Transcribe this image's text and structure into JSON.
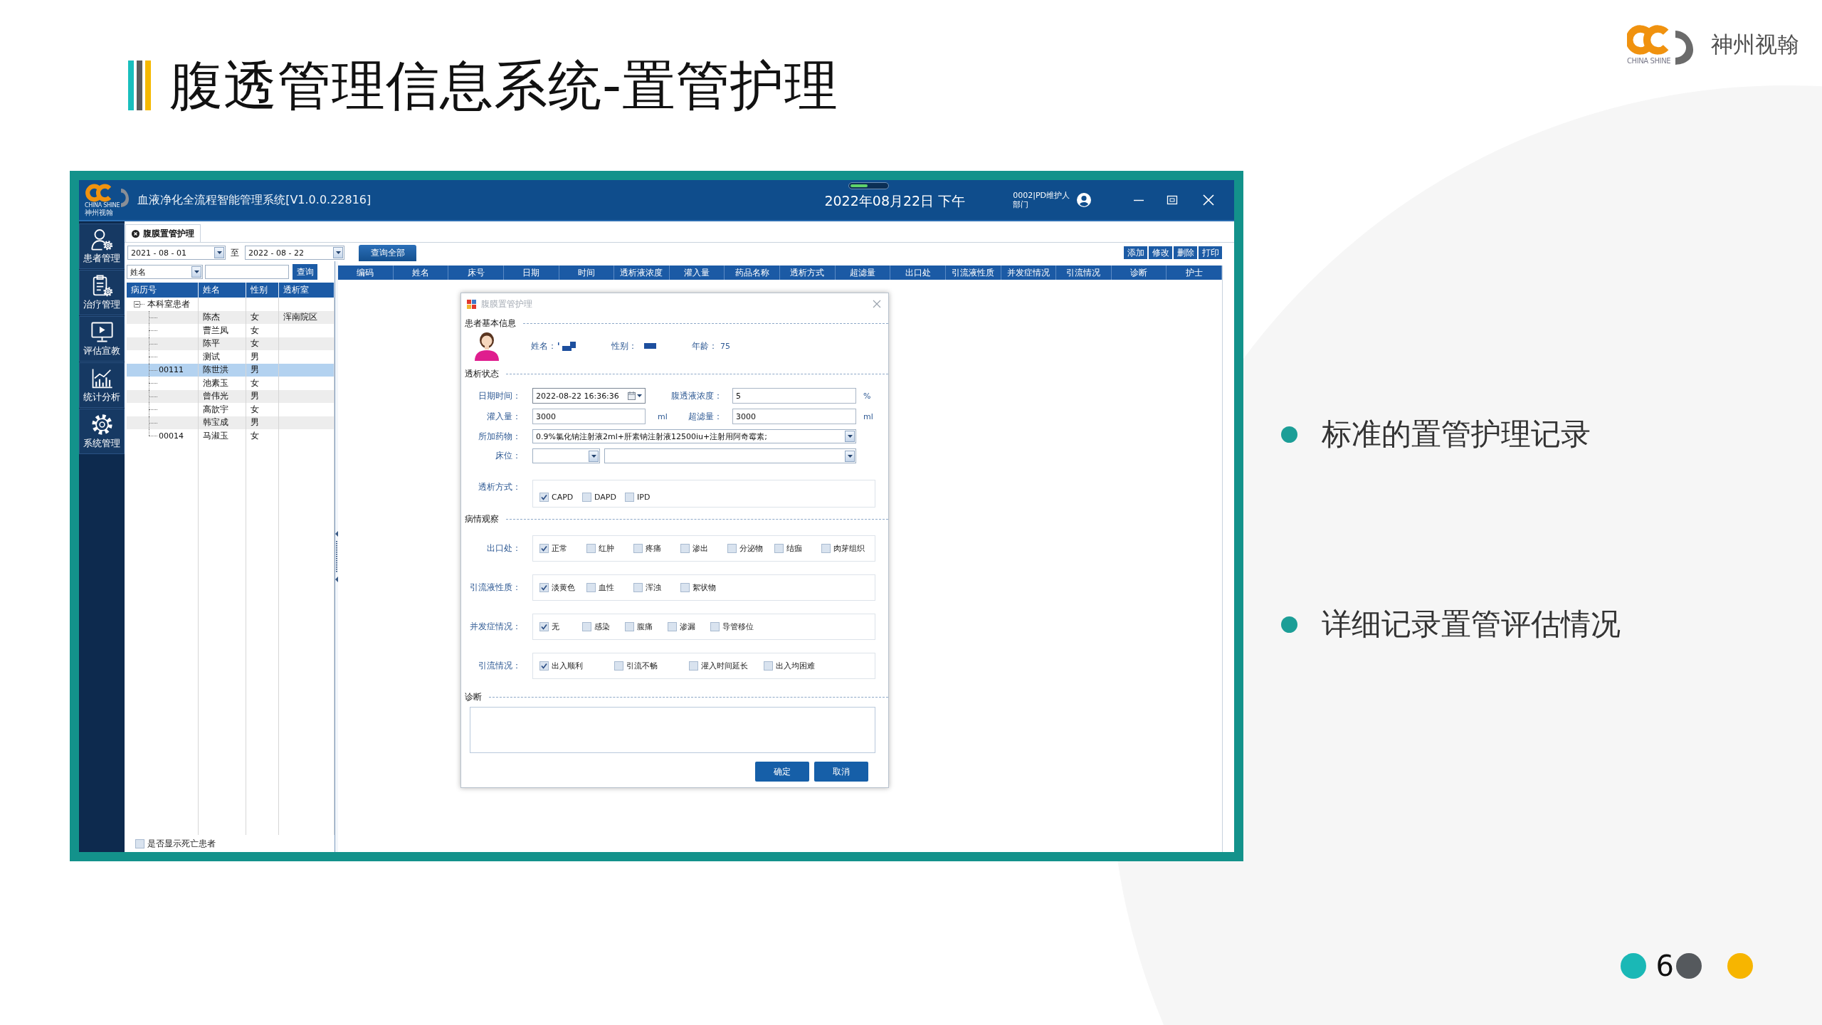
{
  "slide": {
    "title": "腹透管理信息系统-置管护理",
    "logo_caption": "CHINA SHINE",
    "company": "神州视翰",
    "bullets": [
      "标准的置管护理记录",
      "详细记录置管评估情况"
    ],
    "page_number": "6"
  },
  "window": {
    "logo_caption": "CHINA SHINE",
    "logo_name": "神州视翰",
    "title": "血液净化全流程智能管理系统[V1.0.0.22816]",
    "datetime": "2022年08月22日 下午",
    "user": "0002|PD维护人",
    "department": "部门"
  },
  "sidebar": {
    "items": [
      {
        "kind": "patients",
        "label": "患者管理"
      },
      {
        "kind": "treatment",
        "label": "治疗管理"
      },
      {
        "kind": "education",
        "label": "评估宣教"
      },
      {
        "kind": "statistics",
        "label": "统计分析"
      },
      {
        "kind": "settings",
        "label": "系统管理"
      }
    ]
  },
  "tab": {
    "label": "腹膜置管护理"
  },
  "filter": {
    "date_from": "2021 - 08 - 01",
    "range_separator": "至",
    "date_to": "2022 - 08 - 22",
    "query_all_button": "查询全部",
    "search_by": "姓名",
    "search_button": "查询"
  },
  "toolbar": [
    "添加",
    "修改",
    "删除",
    "打印"
  ],
  "patient_tree": {
    "columns": [
      "病历号",
      "姓名",
      "性别",
      "透析室"
    ],
    "root": {
      "label": "本科室患者",
      "expanded": true,
      "children": [
        {
          "name": "陈杰",
          "sex": "女",
          "room": "浑南院区",
          "selected": false
        },
        {
          "name": "曹兰凤",
          "sex": "女",
          "selected": false
        },
        {
          "name": "陈平",
          "sex": "女",
          "selected": false
        },
        {
          "name": "测试",
          "sex": "男",
          "selected": false
        },
        {
          "id": "00111",
          "name": "陈世洪",
          "sex": "男",
          "selected": true
        },
        {
          "name": "池素玉",
          "sex": "女",
          "selected": false
        },
        {
          "name": "曾伟光",
          "sex": "男",
          "selected": false
        },
        {
          "name": "高歆宇",
          "sex": "女",
          "selected": false
        },
        {
          "name": "韩宝成",
          "sex": "男",
          "selected": false
        },
        {
          "id": "00014",
          "name": "马淑玉",
          "sex": "女",
          "selected": false
        }
      ]
    }
  },
  "show_deceased": {
    "label": "是否显示死亡患者",
    "checked": false
  },
  "records_table": {
    "columns": [
      "编码",
      "姓名",
      "床号",
      "日期",
      "时间",
      "透析液浓度",
      "灌入量",
      "药品名称",
      "透析方式",
      "超滤量",
      "出口处",
      "引流液性质",
      "并发症情况",
      "引流情况",
      "诊断",
      "护士"
    ]
  },
  "dialog": {
    "title": "腹膜置管护理",
    "patient": {
      "heading": "患者基本信息",
      "fields": [
        {
          "label": "姓名：",
          "redacted": true
        },
        {
          "label": "性别：",
          "redacted": true
        },
        {
          "label": "年龄：",
          "value": "75"
        }
      ]
    },
    "status": {
      "heading": "透析状态",
      "fields": [
        {
          "kind": "datetime",
          "label": "日期时间：",
          "value": "2022-08-22 16:36:36"
        },
        {
          "kind": "text",
          "label": "腹透液浓度：",
          "value": "5",
          "unit": "%"
        },
        {
          "kind": "text",
          "label": "灌入量：",
          "value": "3000",
          "unit": "ml"
        },
        {
          "kind": "text",
          "label": "超滤量：",
          "value": "3000",
          "unit": "ml"
        },
        {
          "kind": "combo",
          "label": "所加药物：",
          "value": "0.9%氯化钠注射液2ml+肝素钠注射液12500iu+注射用阿奇霉素;"
        },
        {
          "kind": "bed",
          "label": "床位："
        }
      ],
      "mode": {
        "label": "透析方式：",
        "options": [
          {
            "label": "CAPD",
            "checked": true
          },
          {
            "label": "DAPD",
            "checked": false
          },
          {
            "label": "IPD",
            "checked": false
          }
        ]
      }
    },
    "observation": {
      "heading": "病情观察",
      "groups": [
        {
          "label": "出口处：",
          "options": [
            {
              "label": "正常",
              "checked": true
            },
            {
              "label": "红肿",
              "checked": false
            },
            {
              "label": "疼痛",
              "checked": false
            },
            {
              "label": "渗出",
              "checked": false
            },
            {
              "label": "分泌物",
              "checked": false
            },
            {
              "label": "结痂",
              "checked": false
            },
            {
              "label": "肉芽组织",
              "checked": false
            }
          ]
        },
        {
          "label": "引流液性质：",
          "options": [
            {
              "label": "淡黄色",
              "checked": true
            },
            {
              "label": "血性",
              "checked": false
            },
            {
              "label": "浑浊",
              "checked": false
            },
            {
              "label": "絮状物",
              "checked": false
            }
          ]
        },
        {
          "label": "并发症情况：",
          "options": [
            {
              "label": "无",
              "checked": true
            },
            {
              "label": "感染",
              "checked": false
            },
            {
              "label": "腹痛",
              "checked": false
            },
            {
              "label": "渗漏",
              "checked": false
            },
            {
              "label": "导管移位",
              "checked": false
            }
          ]
        },
        {
          "label": "引流情况：",
          "options": [
            {
              "label": "出入顺利",
              "checked": true
            },
            {
              "label": "引流不畅",
              "checked": false
            },
            {
              "label": "灌入时间延长",
              "checked": false
            },
            {
              "label": "出入均困难",
              "checked": false
            }
          ]
        }
      ]
    },
    "diagnosis": {
      "heading": "诊断"
    },
    "buttons": [
      "确定",
      "取消"
    ]
  }
}
